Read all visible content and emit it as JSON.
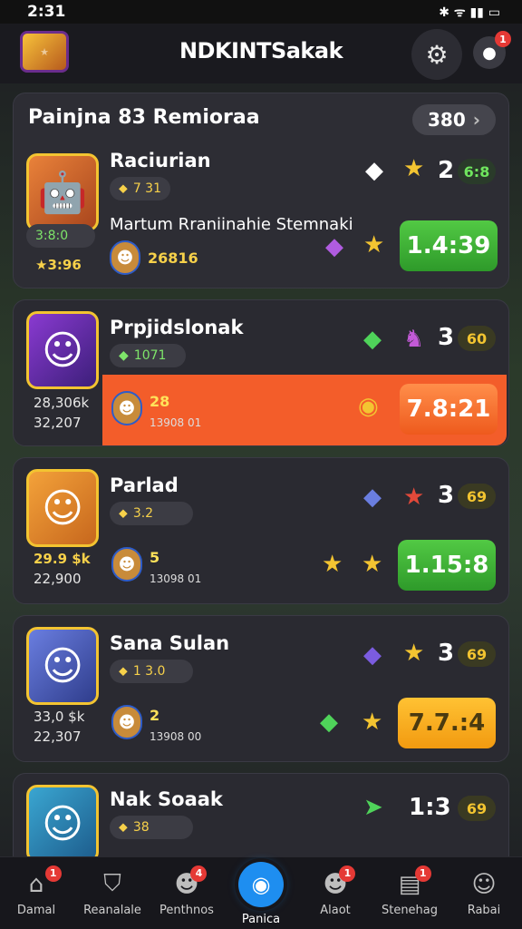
{
  "status": {
    "time": "2:31",
    "icons": "✱ ᯤ ▮▮ ▭"
  },
  "header": {
    "title": "NDKINTSakak",
    "notification_count": "1"
  },
  "section": {
    "title": "Painjna 83 Remioraa",
    "pill_value": "380",
    "pill_arrow": "›"
  },
  "rows": [
    {
      "name": "Raciurian",
      "chip": "7 31",
      "rank": "2",
      "rank_pill": "6:8",
      "avatar_icon": "robot",
      "side_badge": "3:8:0",
      "side_stat": "★3:96",
      "sub_title": "Martum Rraniinahie Stemnaki",
      "sub_value": "26816",
      "timer": "1.4:39"
    },
    {
      "name": "Prpjidslonak",
      "chip": "1071",
      "rank": "3",
      "rank_pill": "60",
      "stat_top": "28,306k",
      "stat_bottom": "32,207",
      "sub_value": "28",
      "sub_sub": "13908 01",
      "timer": "7.8:21"
    },
    {
      "name": "Parlad",
      "chip": "3.2",
      "rank": "3",
      "rank_pill": "69",
      "stat_top": "29.9 $k",
      "stat_bottom": "22,900",
      "sub_value": "5",
      "sub_sub": "13098 01",
      "timer": "1.15:8"
    },
    {
      "name": "Sana Sulan",
      "chip": "1 3.0",
      "rank": "3",
      "rank_pill": "69",
      "stat_top": "33,0 $k",
      "stat_bottom": "22,307",
      "sub_value": "2",
      "sub_sub": "13908 00",
      "timer": "7.7.:4"
    },
    {
      "name": "Nak Soaak",
      "chip": "38",
      "rank": "1:3",
      "rank_pill": "69"
    }
  ],
  "nav": [
    {
      "label": "Damal",
      "icon": "home-icon",
      "badge": "1"
    },
    {
      "label": "Reanalale",
      "icon": "shield-icon",
      "badge": ""
    },
    {
      "label": "Penthnos",
      "icon": "people-icon",
      "badge": "4"
    },
    {
      "label": "Panica",
      "icon": "compass-icon",
      "badge": ""
    },
    {
      "label": "Alaot",
      "icon": "user-icon",
      "badge": "1"
    },
    {
      "label": "Stenehag",
      "icon": "inbox-icon",
      "badge": "1"
    },
    {
      "label": "Rabai",
      "icon": "profile-icon",
      "badge": ""
    }
  ]
}
